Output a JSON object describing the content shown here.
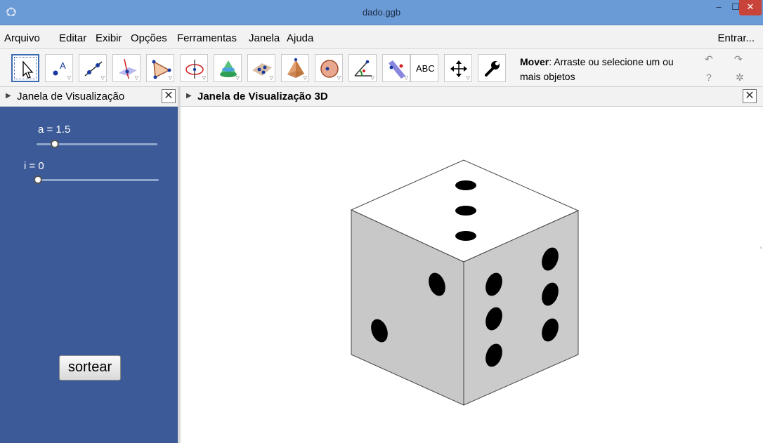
{
  "window": {
    "title": "dado.ggb",
    "minimize_glyph": "‒",
    "maximize_glyph": "☐",
    "close_glyph": "✕"
  },
  "menu": {
    "items": [
      "Arquivo",
      "Editar",
      "Exibir",
      "Opções",
      "Ferramentas",
      "Janela",
      "Ajuda"
    ],
    "signin": "Entrar..."
  },
  "toolbar": {
    "tools": [
      {
        "name": "move-tool-icon"
      },
      {
        "name": "point-tool-icon"
      },
      {
        "name": "line-tool-icon"
      },
      {
        "name": "perpendicular-tool-icon"
      },
      {
        "name": "polygon-tool-icon"
      },
      {
        "name": "circle-axis-tool-icon"
      },
      {
        "name": "intersect-surfaces-tool-icon"
      },
      {
        "name": "plane-tool-icon"
      },
      {
        "name": "pyramid-tool-icon"
      },
      {
        "name": "sphere-tool-icon"
      },
      {
        "name": "angle-tool-icon"
      },
      {
        "name": "reflect-tool-icon"
      },
      {
        "name": "text-tool-icon",
        "label": "ABC"
      },
      {
        "name": "move-graphics-tool-icon"
      },
      {
        "name": "properties-tool-icon"
      }
    ],
    "help_title": "Mover",
    "help_text": ": Arraste ou selecione um ou mais objetos",
    "undo_glyph": "↶",
    "redo_glyph": "↷",
    "help_glyph": "?",
    "settings_glyph": "✲"
  },
  "left_panel": {
    "title": "Janela de Visualização",
    "sliders": [
      {
        "label": "a = 1.5",
        "value": 1.5
      },
      {
        "label": "i = 0",
        "value": 0
      }
    ],
    "button_label": "sortear"
  },
  "right_panel": {
    "title": "Janela de Visualização 3D"
  },
  "die": {
    "top_pips": 3,
    "left_pips": 2,
    "right_pips": 6,
    "colors": {
      "top": "#ffffff",
      "left": "#c8c8c8",
      "right": "#cbcbcb",
      "pip": "#000000",
      "edge": "#444444"
    }
  },
  "colors": {
    "panel_blue": "#3c5a98",
    "titlebar": "#6b9bd6",
    "close_red": "#c8443a"
  }
}
